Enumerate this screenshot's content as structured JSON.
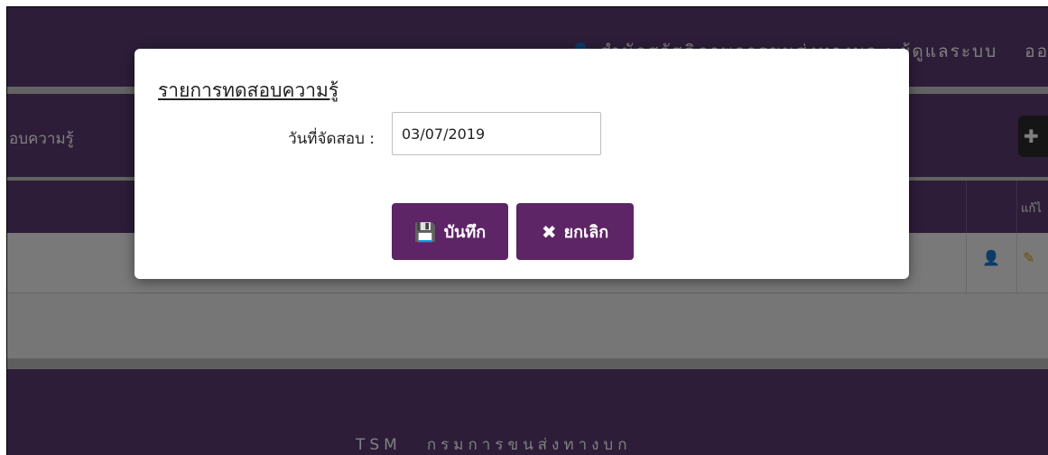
{
  "header": {
    "user_text": "สำนักสวัสดิภาพการขนส่งทางบก : ผู้ดูแลระบบ",
    "logout_label": "ออ"
  },
  "panel": {
    "title": "อบความรู้",
    "add_button_icon": "plus-circle-icon"
  },
  "table": {
    "edit_header": "แก้ไ",
    "row_icons": [
      "user-icon",
      "edit-pencil-icon"
    ]
  },
  "footer": {
    "brand": "TSM",
    "org": "กรมการขนส่งทางบก"
  },
  "modal": {
    "title": "รายการทดสอบความรู้",
    "date_label": "วันที่จัดสอบ :",
    "date_value": "03/07/2019",
    "save_label": "บันทึก",
    "save_icon": "floppy-disk-icon",
    "cancel_label": "ยกเลิก",
    "cancel_icon": "x-icon"
  },
  "colors": {
    "header_purple": "#5a3a72",
    "button_purple": "#5d2466",
    "overlay": "rgba(0,0,0,0.5)"
  }
}
